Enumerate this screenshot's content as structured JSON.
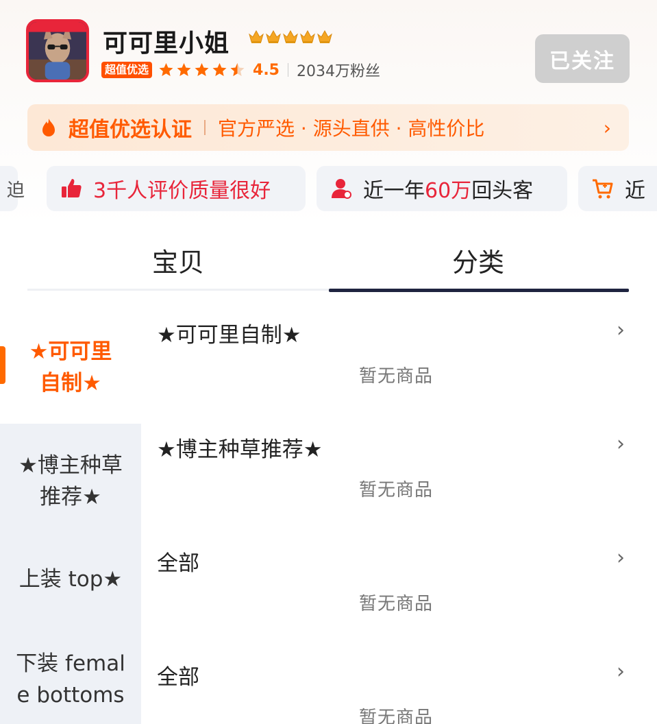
{
  "shop": {
    "name": "可可里小姐",
    "value_badge": "超值优选",
    "rating": "4.5",
    "fans": "2034万粉丝",
    "follow_label": "已关注"
  },
  "certification": {
    "title": "超值优选认证",
    "description": "官方严选 · 源头直供 · 高性价比",
    "arrow": "›"
  },
  "highlights": [
    {
      "prefix": "3千人评价",
      "highlight": "质量很好",
      "suffix": ""
    },
    {
      "prefix": "近一年",
      "highlight": "60万",
      "suffix": "回头客"
    },
    {
      "prefix": "近",
      "highlight": "",
      "suffix": ""
    }
  ],
  "tabs": [
    {
      "label": "宝贝"
    },
    {
      "label": "分类"
    }
  ],
  "sidebar": {
    "items": [
      {
        "line1": "★可可里",
        "line2": "自制★"
      },
      {
        "line1": "★博主种草",
        "line2": "推荐★"
      },
      {
        "line1": "上装 top★",
        "line2": ""
      },
      {
        "line1": "下装 femal",
        "line2": "e bottoms"
      }
    ]
  },
  "categories": [
    {
      "title": "★可可里自制★",
      "empty": "暂无商品"
    },
    {
      "title": "★博主种草推荐★",
      "empty": "暂无商品"
    },
    {
      "title": "全部",
      "empty": "暂无商品"
    },
    {
      "title": "全部",
      "empty": "暂无商品"
    }
  ],
  "icons": {
    "crown": "crown-icon",
    "star": "star-icon",
    "cert": "flame-icon",
    "thumb": "thumbs-up-icon",
    "user": "user-icon",
    "cart": "cart-icon"
  },
  "colors": {
    "accent": "#ff5a00",
    "highlight_red": "#e8253a",
    "follow_bg": "#cfcfcf",
    "tab_underline": "#1f2440"
  }
}
